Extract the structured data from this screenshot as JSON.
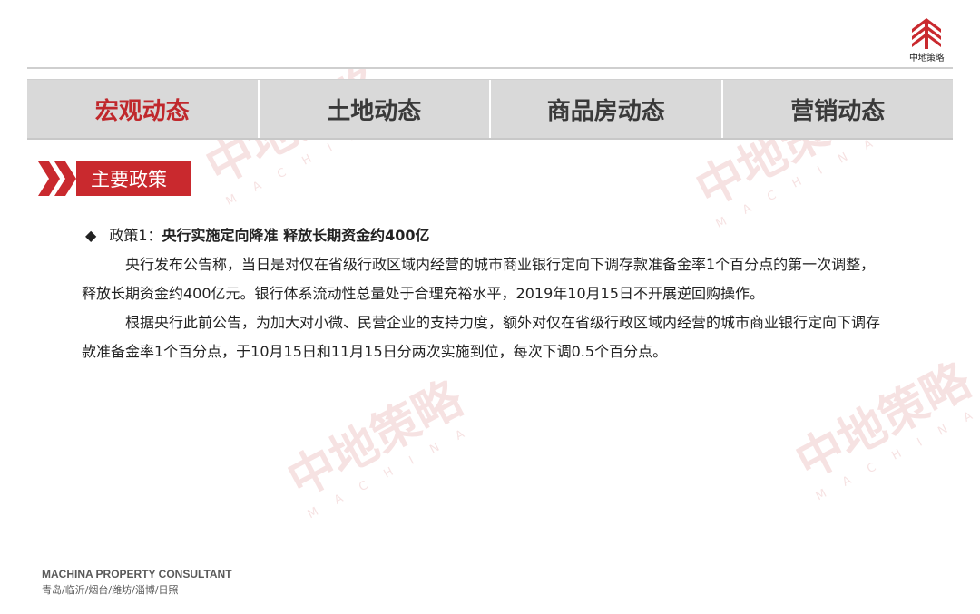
{
  "brand": {
    "logo_text": "中地策略",
    "logo_icon": "building-logo-icon",
    "accent_color": "#c0282c"
  },
  "tabs": [
    {
      "label": "宏观动态",
      "active": true
    },
    {
      "label": "土地动态",
      "active": false
    },
    {
      "label": "商品房动态",
      "active": false
    },
    {
      "label": "营销动态",
      "active": false
    }
  ],
  "section": {
    "label": "主要政策",
    "icon": "double-chevron-icon"
  },
  "policy": {
    "bullet": "◆",
    "prefix": "政策1：",
    "title": "央行实施定向降准 释放长期资金约400亿",
    "paragraphs": [
      "央行发布公告称，当日是对仅在省级行政区域内经营的城市商业银行定向下调存款准备金率1个百分点的第一次调整，释放长期资金约400亿元。银行体系流动性总量处于合理充裕水平，2019年10月15日不开展逆回购操作。",
      "根据央行此前公告，为加大对小微、民营企业的支持力度，额外对仅在省级行政区域内经营的城市商业银行定向下调存款准备金率1个百分点，于10月15日和11月15日分两次实施到位，每次下调0.5个百分点。"
    ]
  },
  "watermark": {
    "text": "中地策略",
    "sub": "MACHINA"
  },
  "footer": {
    "company": "MACHINA PROPERTY CONSULTANT",
    "cities": "青岛/临沂/烟台/潍坊/淄博/日照"
  }
}
